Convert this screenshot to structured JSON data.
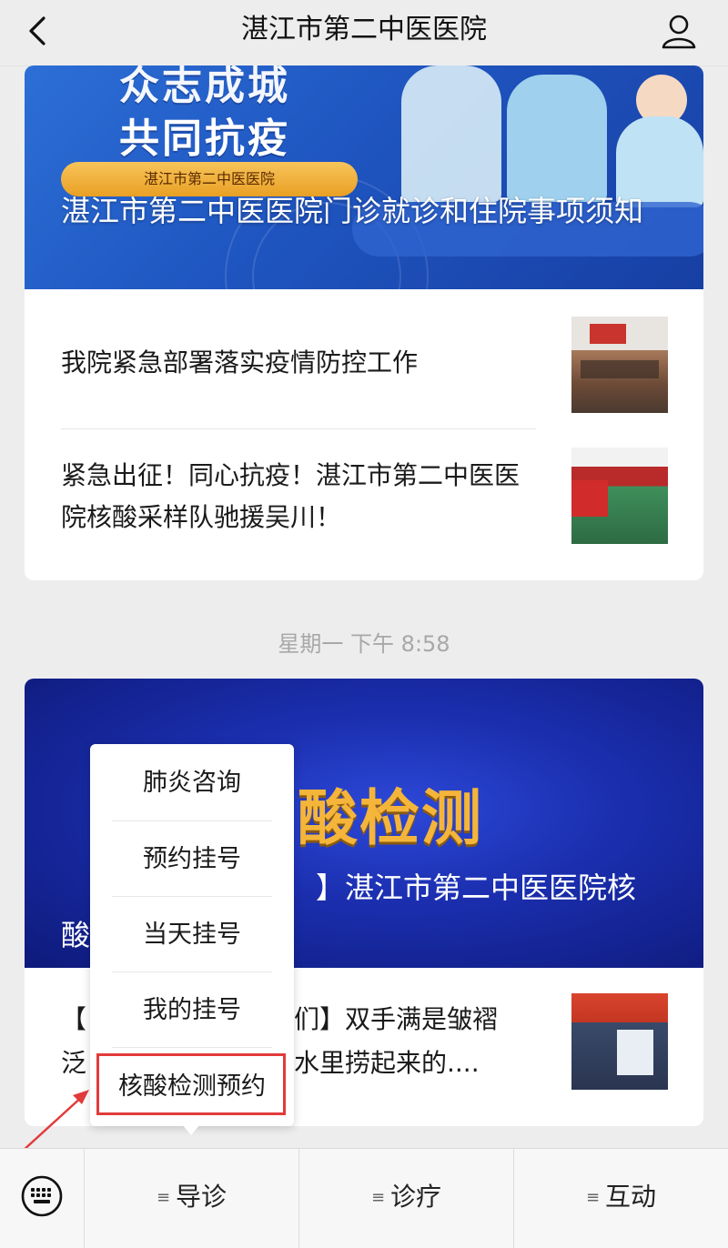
{
  "header": {
    "title": "湛江市第二中医医院"
  },
  "feed1": {
    "banner": {
      "slogan_line1": "众志成城",
      "slogan_line2": "共同抗疫",
      "pill_text": "湛江市第二中医医院",
      "title": "湛江市第二中医医院门诊就诊和住院事项须知"
    },
    "items": [
      {
        "title": "我院紧急部署落实疫情防控工作"
      },
      {
        "title": "紧急出征！同心抗疫！湛江市第二中医医院核酸采样队驰援吴川！"
      }
    ]
  },
  "timestamp": "星期一 下午 8:58",
  "feed2": {
    "banner": {
      "big_text": "酸检测",
      "title_visible_right": "】湛江市第二中医医院核",
      "title_line2_start": "酸"
    },
    "item": {
      "line1_left": "【",
      "line1_right": "们】双手满是皱褶",
      "line2_left": "泛",
      "line2_right": "水里捞起来的...."
    }
  },
  "popup_menu": {
    "items": [
      "肺炎咨询",
      "预约挂号",
      "当天挂号",
      "我的挂号",
      "核酸检测预约"
    ],
    "highlight_color": "#e23a3a"
  },
  "bottom_bar": {
    "tabs": [
      {
        "label": "导诊"
      },
      {
        "label": "诊疗"
      },
      {
        "label": "互动"
      }
    ],
    "menu_glyph": "≡"
  },
  "colors": {
    "background": "#ededed",
    "banner1": "#1f55c0",
    "banner2": "#1b2fb0",
    "accent_red": "#e23a3a"
  }
}
